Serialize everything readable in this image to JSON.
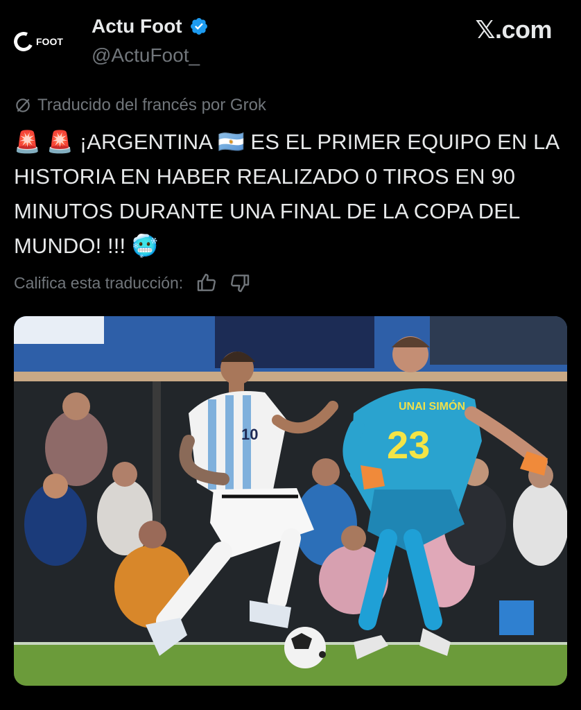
{
  "tweet": {
    "author_name": "Actu Foot",
    "handle": "@ActuFoot_",
    "avatar_text": "FOOT",
    "brand": "𝕏.com",
    "translated_label": "Traducido del francés por Grok",
    "text": "🚨 🚨 ¡ARGENTINA 🇦🇷 ES EL PRIMER EQUIPO EN LA HISTORIA EN HABER REALIZADO 0 TIROS EN 90 MINUTOS DURANTE UNA FINAL DE LA COPA DEL MUNDO! !!! 🥶",
    "rate_label": "Califica esta traducción:"
  },
  "media": {
    "jersey_name": "UNAI SIMÓN",
    "jersey_number": "23",
    "player2_number": "10"
  },
  "colors": {
    "background": "#000000",
    "text": "#e7e9ea",
    "secondary": "#71767b",
    "verified": "#1d9bf0"
  },
  "icons": {
    "verified": "verified-badge-icon",
    "translate": "translation-icon",
    "thumbs_up": "thumbs-up-icon",
    "thumbs_down": "thumbs-down-icon"
  }
}
